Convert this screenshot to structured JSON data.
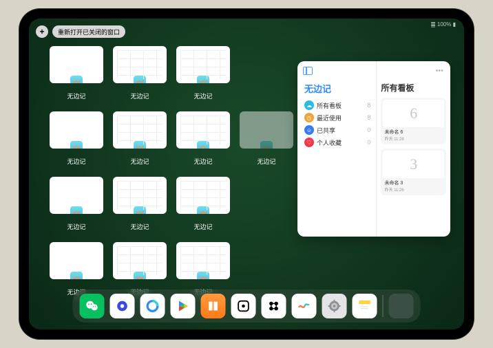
{
  "status": {
    "indicators": "䷀ 100% ▮"
  },
  "topbar": {
    "plus_label": "+",
    "reopen_label": "重新打开已关闭的窗口"
  },
  "app_switcher": {
    "tile_label": "无边记",
    "tiles": [
      {
        "variant": "blank"
      },
      {
        "variant": "grid"
      },
      {
        "variant": "grid"
      },
      {
        "variant": "none"
      },
      {
        "variant": "blank"
      },
      {
        "variant": "grid"
      },
      {
        "variant": "grid"
      },
      {
        "variant": "ghost"
      },
      {
        "variant": "blank"
      },
      {
        "variant": "grid"
      },
      {
        "variant": "grid"
      },
      {
        "variant": "none"
      },
      {
        "variant": "blank"
      },
      {
        "variant": "grid"
      },
      {
        "variant": "grid"
      },
      {
        "variant": "none"
      }
    ]
  },
  "panel": {
    "app_title": "无边记",
    "right_title": "所有看板",
    "categories": [
      {
        "label": "所有看板",
        "count": "8",
        "color": "#2bbde0",
        "glyph": "☁"
      },
      {
        "label": "最近使用",
        "count": "8",
        "color": "#f0a33a",
        "glyph": "◷"
      },
      {
        "label": "已共享",
        "count": "0",
        "color": "#3a7bf0",
        "glyph": "☺"
      },
      {
        "label": "个人收藏",
        "count": "0",
        "color": "#f03a4a",
        "glyph": "♡"
      }
    ],
    "cards": [
      {
        "glyph": "6",
        "title": "未命名 6",
        "sub": "昨天 11:28"
      },
      {
        "glyph": "3",
        "title": "未命名 3",
        "sub": "昨天 11:26"
      }
    ]
  },
  "dock": {
    "apps": [
      "wechat",
      "quark",
      "qq-browser",
      "play",
      "books",
      "dice",
      "flomo",
      "freeform",
      "settings",
      "notes"
    ],
    "recent": [
      "recent-cluster"
    ]
  }
}
